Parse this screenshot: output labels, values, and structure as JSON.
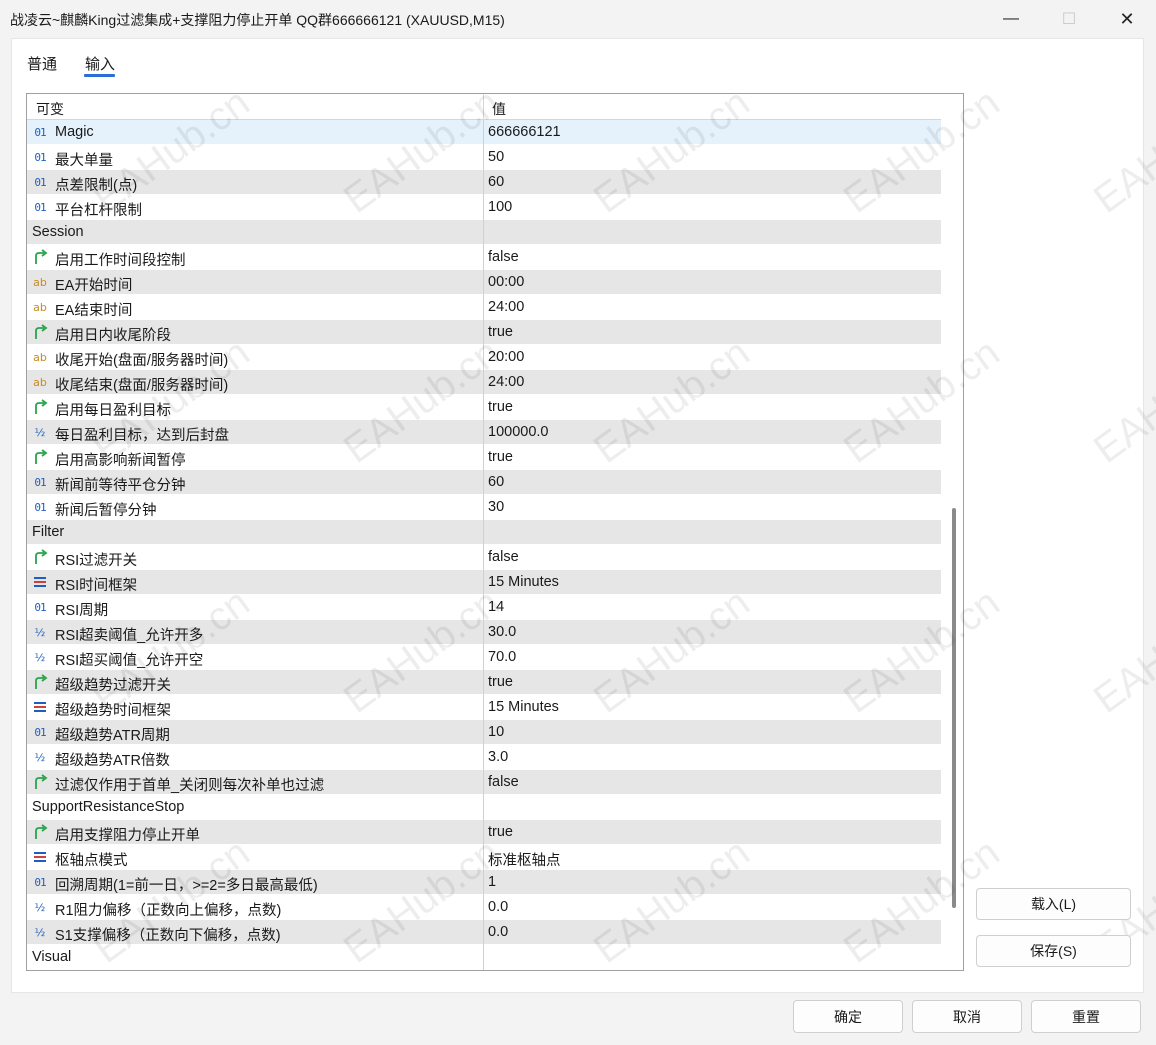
{
  "window": {
    "title": "战凌云~麒麟King过滤集成+支撑阻力停止开单 QQ群666666121 (XAUUSD,M15)",
    "minimize": "—",
    "maximize": "☐",
    "close": "✕"
  },
  "tabs": [
    {
      "label": "普通"
    },
    {
      "label": "输入"
    }
  ],
  "grid": {
    "header_name": "可变",
    "header_value": "值",
    "rows": [
      {
        "type": "int",
        "name": "Magic",
        "value": "666666121",
        "selected": true
      },
      {
        "type": "int",
        "name": "最大单量",
        "value": "50"
      },
      {
        "type": "int",
        "name": "点差限制(点)",
        "value": "60"
      },
      {
        "type": "int",
        "name": "平台杠杆限制",
        "value": "100"
      },
      {
        "type": "group",
        "name": "Session",
        "value": ""
      },
      {
        "type": "bool",
        "name": "启用工作时间段控制",
        "value": "false"
      },
      {
        "type": "string",
        "name": "EA开始时间",
        "value": "00:00"
      },
      {
        "type": "string",
        "name": "EA结束时间",
        "value": "24:00"
      },
      {
        "type": "bool",
        "name": "启用日内收尾阶段",
        "value": "true"
      },
      {
        "type": "string",
        "name": "收尾开始(盘面/服务器时间)",
        "value": "20:00"
      },
      {
        "type": "string",
        "name": "收尾结束(盘面/服务器时间)",
        "value": "24:00"
      },
      {
        "type": "bool",
        "name": "启用每日盈利目标",
        "value": "true"
      },
      {
        "type": "double",
        "name": "每日盈利目标，达到后封盘",
        "value": "100000.0"
      },
      {
        "type": "bool",
        "name": "启用高影响新闻暂停",
        "value": "true"
      },
      {
        "type": "int",
        "name": "新闻前等待平仓分钟",
        "value": "60"
      },
      {
        "type": "int",
        "name": "新闻后暂停分钟",
        "value": "30"
      },
      {
        "type": "group",
        "name": "Filter",
        "value": ""
      },
      {
        "type": "bool",
        "name": "RSI过滤开关",
        "value": "false"
      },
      {
        "type": "enum",
        "name": "RSI时间框架",
        "value": "15 Minutes"
      },
      {
        "type": "int",
        "name": "RSI周期",
        "value": "14"
      },
      {
        "type": "double",
        "name": "RSI超卖阈值_允许开多",
        "value": "30.0"
      },
      {
        "type": "double",
        "name": "RSI超买阈值_允许开空",
        "value": "70.0"
      },
      {
        "type": "bool",
        "name": "超级趋势过滤开关",
        "value": "true"
      },
      {
        "type": "enum",
        "name": "超级趋势时间框架",
        "value": "15 Minutes"
      },
      {
        "type": "int",
        "name": "超级趋势ATR周期",
        "value": "10"
      },
      {
        "type": "double",
        "name": "超级趋势ATR倍数",
        "value": "3.0"
      },
      {
        "type": "bool",
        "name": "过滤仅作用于首单_关闭则每次补单也过滤",
        "value": "false"
      },
      {
        "type": "group",
        "name": "SupportResistanceStop",
        "value": ""
      },
      {
        "type": "bool",
        "name": "启用支撑阻力停止开单",
        "value": "true"
      },
      {
        "type": "enum",
        "name": "枢轴点模式",
        "value": "标准枢轴点"
      },
      {
        "type": "int",
        "name": "回溯周期(1=前一日，>=2=多日最高最低)",
        "value": "1"
      },
      {
        "type": "double",
        "name": "R1阻力偏移（正数向上偏移，点数)",
        "value": "0.0"
      },
      {
        "type": "double",
        "name": "S1支撑偏移（正数向下偏移，点数)",
        "value": "0.0"
      },
      {
        "type": "group",
        "name": "Visual",
        "value": ""
      }
    ]
  },
  "icons": {
    "int": "01",
    "string": "ab",
    "double": "½"
  },
  "watermark_text": "EAHub.cn",
  "buttons": {
    "load": "载入(L)",
    "save": "保存(S)",
    "ok": "确定",
    "cancel": "取消",
    "reset": "重置"
  },
  "colors": {
    "accent": "#2b6fd6",
    "bool_icon": "#2aa34a",
    "int_icon": "#1f5fbf",
    "string_icon": "#c88a1e",
    "selected_row": "#e5f1fb",
    "alt_row": "#e6e6e6"
  }
}
